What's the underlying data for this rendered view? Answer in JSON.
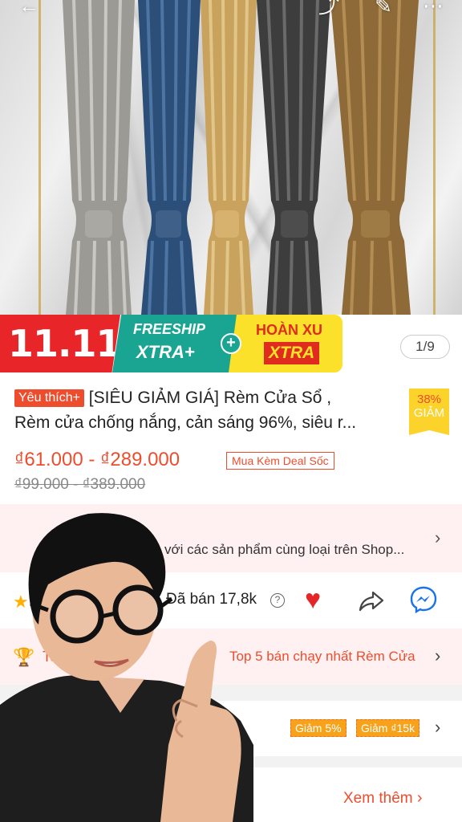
{
  "banner": {
    "sale_label": "11.11",
    "freeship_title": "FREESHIP",
    "freeship_sub": "XTRA+",
    "plus": "+",
    "hoanxu_title": "HOÀN XU",
    "hoanxu_sub": "XTRA",
    "image_counter": "1/9"
  },
  "product": {
    "fav_tag": "Yêu thích+",
    "title_line1": "[SIÊU GIẢM GIÁ] Rèm Cửa Sổ ,",
    "title_line2": "Rèm cửa chống nắng, cản sáng 96%, siêu r...",
    "discount_pct": "38%",
    "discount_label": "GIẢM",
    "price": "₫61.000 - ₫289.000",
    "deal_tag": "Mua Kèm Deal Sốc",
    "old_price": "₫99.000 - ₫389.000"
  },
  "compare": {
    "text": "với các sản phẩm cùng loại trên Shop..."
  },
  "stats": {
    "sold": "Đã bán 17,8k",
    "help": "?"
  },
  "top_selling": {
    "label": "To",
    "text": "Top 5 bán chạy nhất Rèm Cửa"
  },
  "vouchers": [
    "Giảm 5%",
    "Giảm ₫15k"
  ],
  "see_more": "Xem thêm",
  "icons": {
    "chevron": "›",
    "star": "★",
    "heart": "♥",
    "trophy": "🏆"
  },
  "colors": {
    "accent": "#ee4d2d",
    "banner_red": "#e8262a",
    "banner_teal": "#1aa592",
    "banner_yellow": "#fbe12a"
  }
}
